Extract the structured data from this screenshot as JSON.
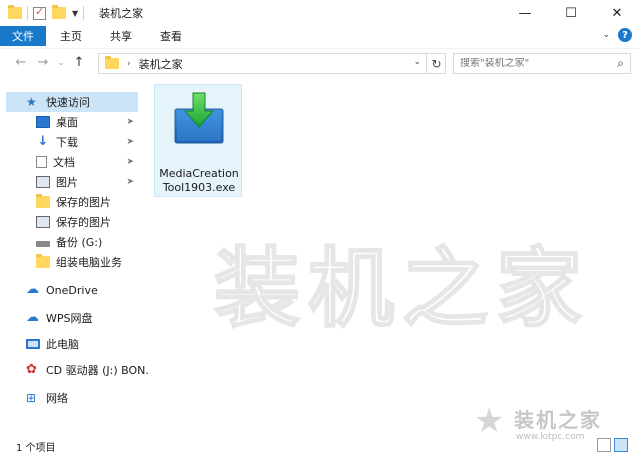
{
  "window": {
    "title": "装机之家",
    "controls": {
      "minimize": "—",
      "maximize": "☐",
      "close": "✕"
    }
  },
  "ribbon": {
    "tabs": [
      "文件",
      "主页",
      "共享",
      "查看"
    ],
    "expand_glyph": "⌄",
    "help_glyph": "?"
  },
  "nav": {
    "back_glyph": "←",
    "forward_glyph": "→",
    "recent_glyph": "⌄",
    "up_glyph": "↑",
    "path_separator": "›",
    "path": [
      "装机之家"
    ],
    "dropdown_glyph": "⌄",
    "refresh_glyph": "↻",
    "search_placeholder": "搜索\"装机之家\"",
    "search_glyph": "⌕"
  },
  "sidebar": {
    "items": [
      {
        "label": "快速访问",
        "icon": "star-icon",
        "pinned": false
      },
      {
        "label": "桌面",
        "icon": "desktop-icon",
        "pinned": true
      },
      {
        "label": "下载",
        "icon": "download-icon",
        "pinned": true
      },
      {
        "label": "文档",
        "icon": "document-icon",
        "pinned": true
      },
      {
        "label": "图片",
        "icon": "picture-icon",
        "pinned": true
      },
      {
        "label": "保存的图片",
        "icon": "folder-icon",
        "pinned": false
      },
      {
        "label": "保存的图片",
        "icon": "picture-icon",
        "pinned": false
      },
      {
        "label": "备份 (G:)",
        "icon": "drive-icon",
        "pinned": false
      },
      {
        "label": "组装电脑业务",
        "icon": "folder-icon",
        "pinned": false
      },
      {
        "label": "OneDrive",
        "icon": "cloud-icon",
        "pinned": false
      },
      {
        "label": "WPS网盘",
        "icon": "cloud-icon",
        "pinned": false
      },
      {
        "label": "此电脑",
        "icon": "computer-icon",
        "pinned": false
      },
      {
        "label": "CD 驱动器 (J:) BON.",
        "icon": "cd-icon",
        "pinned": false
      },
      {
        "label": "网络",
        "icon": "network-icon",
        "pinned": false
      }
    ],
    "pin_glyph": "📌"
  },
  "content": {
    "files": [
      {
        "name_line1": "MediaCreation",
        "name_line2": "Tool1903.exe",
        "icon": "media-creation-tool-icon"
      }
    ]
  },
  "watermark": {
    "big_text": "装机之家",
    "brand": "装机之家",
    "url": "www.lotpc.com"
  },
  "status": {
    "text": "1 个项目"
  },
  "colors": {
    "accent": "#1979ca",
    "selection": "#cce4f7",
    "folder": "#ffd75e"
  }
}
